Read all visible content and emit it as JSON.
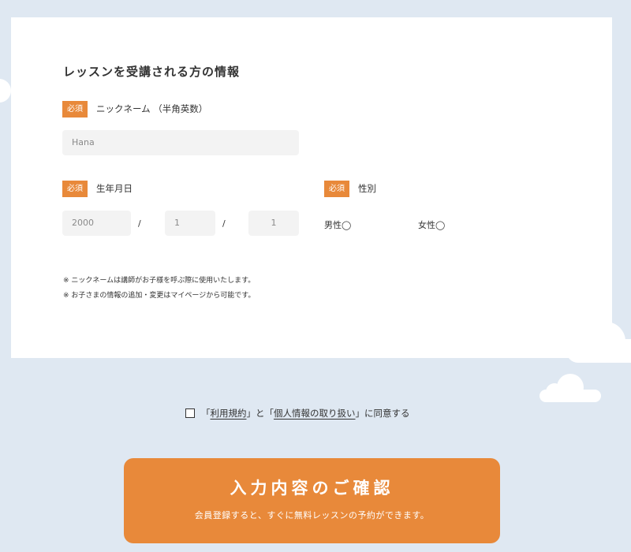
{
  "form": {
    "section_title": "レッスンを受講される方の情報",
    "required_label": "必須",
    "nickname": {
      "label": "ニックネーム （半角英数）",
      "placeholder": "Hana"
    },
    "birthday": {
      "label": "生年月日",
      "year_placeholder": "2000",
      "month_placeholder": "1",
      "day_placeholder": "1",
      "separator": "/"
    },
    "gender": {
      "label": "性別",
      "options": [
        "男性◯",
        "女性◯"
      ]
    },
    "notes": [
      "※ ニックネームは講師がお子様を呼ぶ際に使用いたします。",
      "※ お子さまの情報の追加・変更はマイページから可能です。"
    ]
  },
  "consent": {
    "open1": "「",
    "terms_link": "利用規約",
    "close1": "」",
    "and": "と",
    "open2": "「",
    "privacy_link": "個人情報の取り扱い",
    "close2": "」",
    "suffix": "に同意する"
  },
  "cta": {
    "title": "入力内容のご確認",
    "subtitle": "会員登録すると、すぐに無料レッスンの予約ができます。"
  },
  "colors": {
    "accent": "#e8893a",
    "background": "#dfe8f2",
    "input_bg": "#f3f3f3"
  }
}
